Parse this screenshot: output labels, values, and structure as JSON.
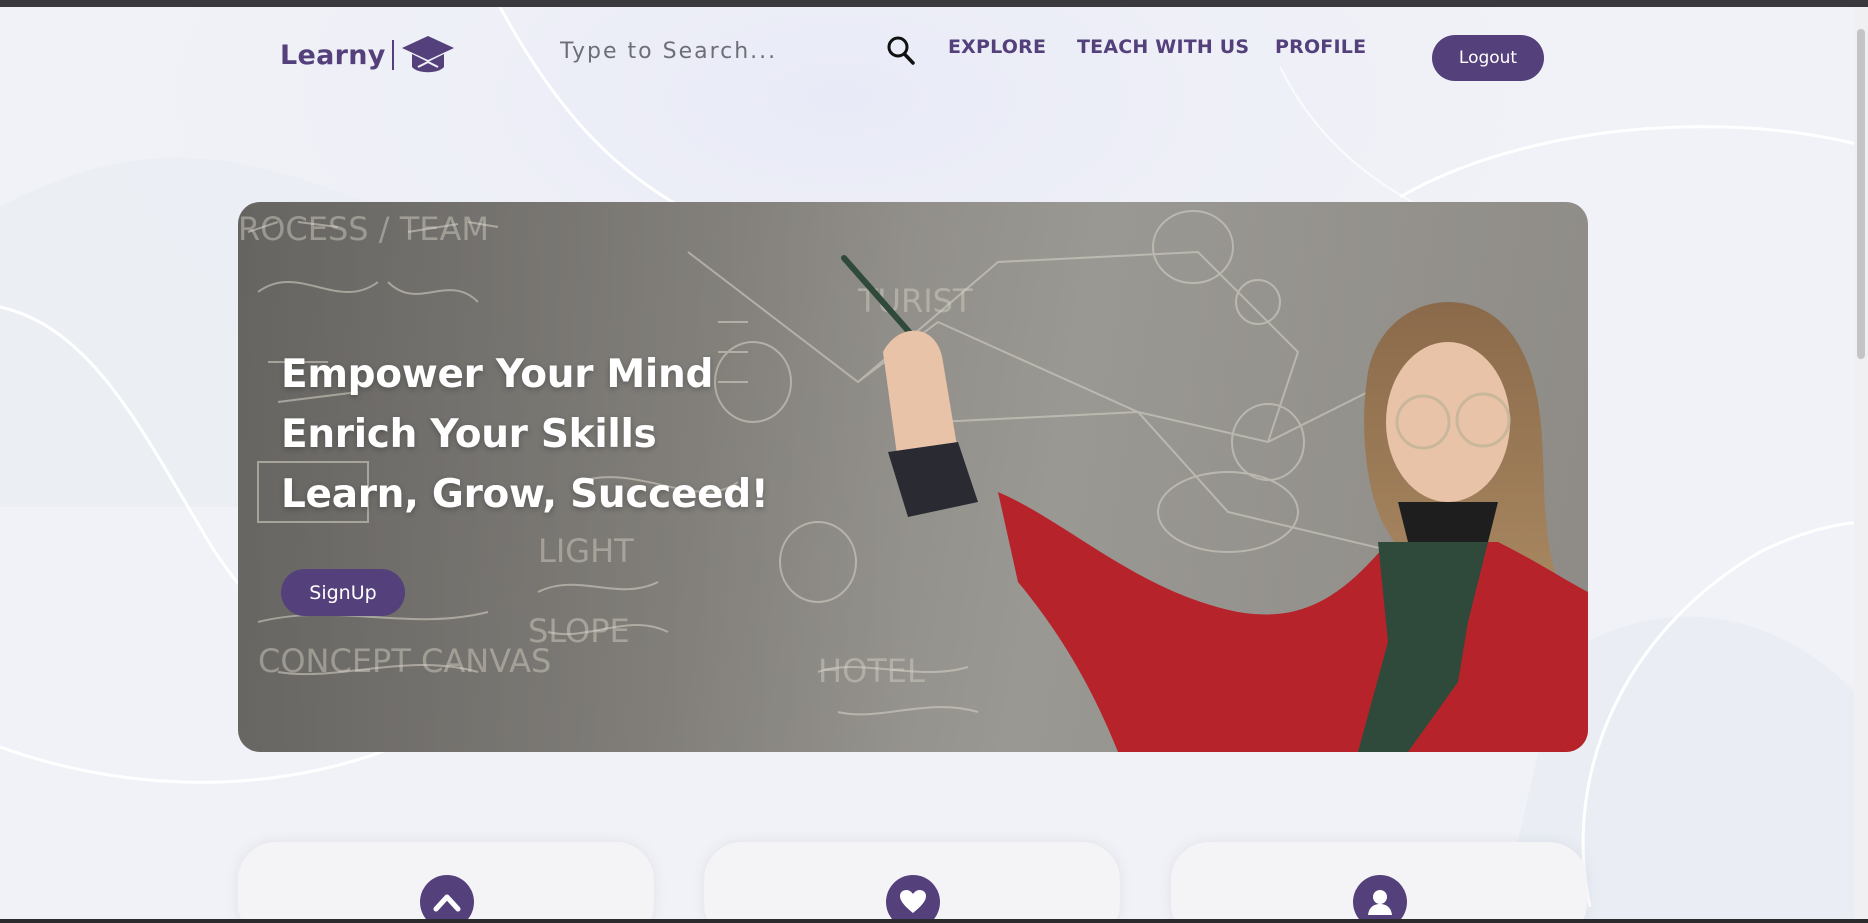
{
  "brand": {
    "name": "Learny",
    "logo_icon": "graduation-cap-icon"
  },
  "search": {
    "placeholder": "Type to Search...",
    "icon": "search-icon"
  },
  "nav": {
    "explore": "EXPLORE",
    "teach": "TEACH WITH US",
    "profile": "PROFILE",
    "logout": "Logout"
  },
  "hero": {
    "line1": "Empower Your Mind",
    "line2": "Enrich Your Skills",
    "line3": "Learn, Grow, Succeed!",
    "signup": "SignUp"
  },
  "features": [
    {
      "icon": "chevron-up-icon"
    },
    {
      "icon": "heart-icon"
    },
    {
      "icon": "user-icon"
    }
  ],
  "colors": {
    "accent": "#54407b",
    "background": "#f1f2f7",
    "hero_text": "#ffffff"
  }
}
